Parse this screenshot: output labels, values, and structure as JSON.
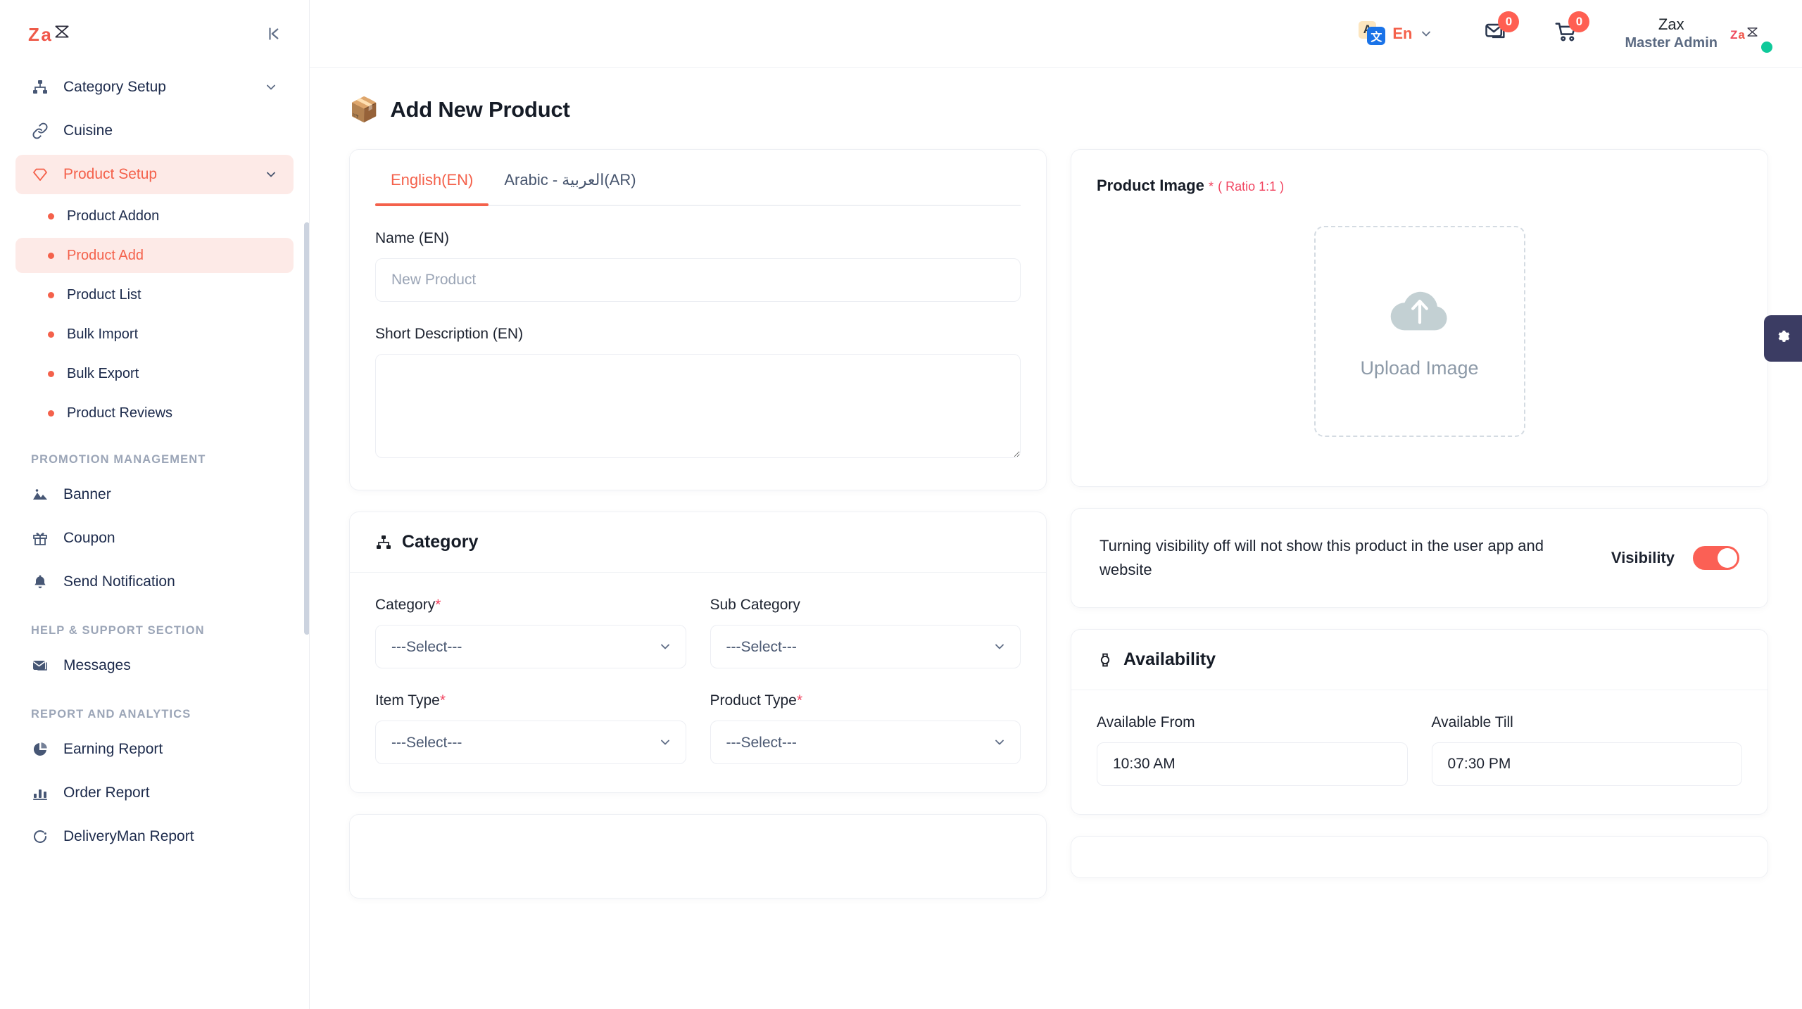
{
  "brand": {
    "logo_z": "Z",
    "logo_a": "a",
    "logo_x": "✗"
  },
  "sidebar": {
    "items": [
      {
        "label": "Category Setup",
        "icon": "sitemap-icon",
        "expandable": true
      },
      {
        "label": "Cuisine",
        "icon": "link-icon",
        "expandable": false
      },
      {
        "label": "Product Setup",
        "icon": "gem-icon",
        "expandable": true,
        "active": true
      }
    ],
    "product_sub_items": [
      {
        "label": "Product Addon"
      },
      {
        "label": "Product Add",
        "active": true
      },
      {
        "label": "Product List"
      },
      {
        "label": "Bulk Import"
      },
      {
        "label": "Bulk Export"
      },
      {
        "label": "Product Reviews"
      }
    ],
    "section_promotion": "PROMOTION MANAGEMENT",
    "promotion_items": [
      {
        "label": "Banner",
        "icon": "image-icon"
      },
      {
        "label": "Coupon",
        "icon": "gift-icon"
      },
      {
        "label": "Send Notification",
        "icon": "bell-icon"
      }
    ],
    "section_help": "HELP & SUPPORT SECTION",
    "help_items": [
      {
        "label": "Messages",
        "icon": "envelope-icon"
      }
    ],
    "section_report": "REPORT AND ANALYTICS",
    "report_items": [
      {
        "label": "Earning Report",
        "icon": "pie-chart-icon"
      },
      {
        "label": "Order Report",
        "icon": "bar-chart-icon"
      },
      {
        "label": "DeliveryMan Report",
        "icon": "refresh-icon"
      }
    ]
  },
  "topbar": {
    "language": "En",
    "messages_badge": "0",
    "cart_badge": "0",
    "profile_name": "Zax",
    "profile_role": "Master Admin"
  },
  "page": {
    "emoji": "📦",
    "title": "Add New Product"
  },
  "lang_tabs": {
    "tabs": [
      {
        "label": "English(EN)",
        "active": true
      },
      {
        "label": "Arabic - العربية(AR)",
        "active": false
      }
    ]
  },
  "name_section": {
    "name_label": "Name (EN)",
    "name_value": "",
    "name_placeholder": "New Product",
    "desc_label": "Short Description (EN)",
    "desc_value": ""
  },
  "product_image": {
    "title": "Product Image",
    "required_mark": "*",
    "ratio_hint": "( Ratio 1:1 )",
    "upload_label": "Upload Image"
  },
  "visibility": {
    "description": "Turning visibility off will not show this product in the user app and website",
    "label": "Visibility",
    "on": true
  },
  "category": {
    "title": "Category",
    "icon": "sitemap-icon",
    "fields": [
      {
        "label": "Category",
        "required": true,
        "value": "---Select---"
      },
      {
        "label": "Sub Category",
        "required": false,
        "value": "---Select---"
      },
      {
        "label": "Item Type",
        "required": true,
        "value": "---Select---"
      },
      {
        "label": "Product Type",
        "required": true,
        "value": "---Select---"
      }
    ]
  },
  "availability": {
    "title": "Availability",
    "icon": "watch-icon",
    "from_label": "Available From",
    "from_value": "10:30 AM",
    "till_label": "Available Till",
    "till_value": "07:30 PM"
  },
  "settings_tab": {
    "icon": "gear-icon"
  },
  "colors": {
    "accent": "#f4614b",
    "accent_soft": "#fdeae7",
    "danger": "#f1435f",
    "toggle_on": "#fb6055",
    "dark_navy": "#3b3c63",
    "text_dark": "#1d2330",
    "text_muted": "#9ba5b7"
  }
}
